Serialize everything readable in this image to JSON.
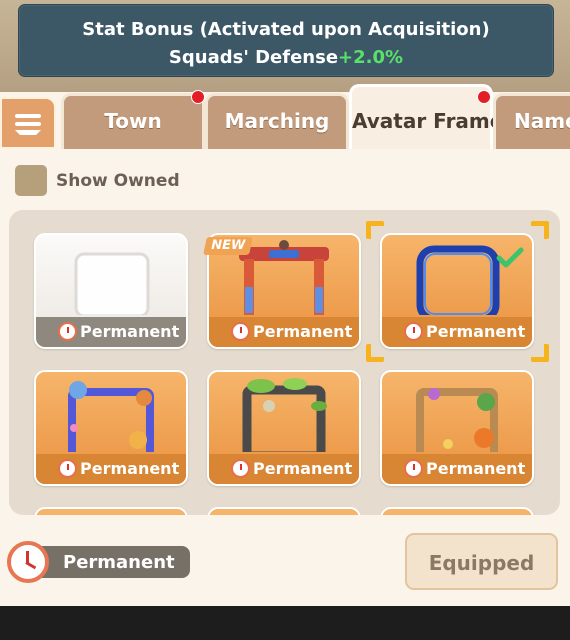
{
  "banner": {
    "title": "Stat Bonus (Activated upon Acquisition)",
    "stat_label": "Squads' Defense",
    "stat_value": "+2.0%"
  },
  "tabs": [
    {
      "label": "Town",
      "badge": true,
      "active": false
    },
    {
      "label": "Marching",
      "badge": false,
      "active": false
    },
    {
      "label": "Avatar Frame",
      "badge": true,
      "active": true
    },
    {
      "label": "Name",
      "badge": false,
      "active": false
    }
  ],
  "filter": {
    "show_owned_label": "Show Owned",
    "checked": false
  },
  "frames": [
    {
      "duration": "Permanent",
      "style": "blank-white"
    },
    {
      "duration": "Permanent",
      "style": "gate",
      "new_label": "NEW"
    },
    {
      "duration": "Permanent",
      "style": "blue-ring",
      "selected": true,
      "equipped": true
    },
    {
      "duration": "Permanent",
      "style": "space-cat"
    },
    {
      "duration": "Permanent",
      "style": "jungle-stone"
    },
    {
      "duration": "Permanent",
      "style": "fruit-frog"
    }
  ],
  "selected": {
    "duration": "Permanent"
  },
  "action": {
    "equip_label": "Equipped"
  },
  "colors": {
    "accent_orange": "#ea9240",
    "bonus_green": "#59e06a",
    "badge_red": "#e21f26",
    "selection_gold": "#f6b31b"
  }
}
